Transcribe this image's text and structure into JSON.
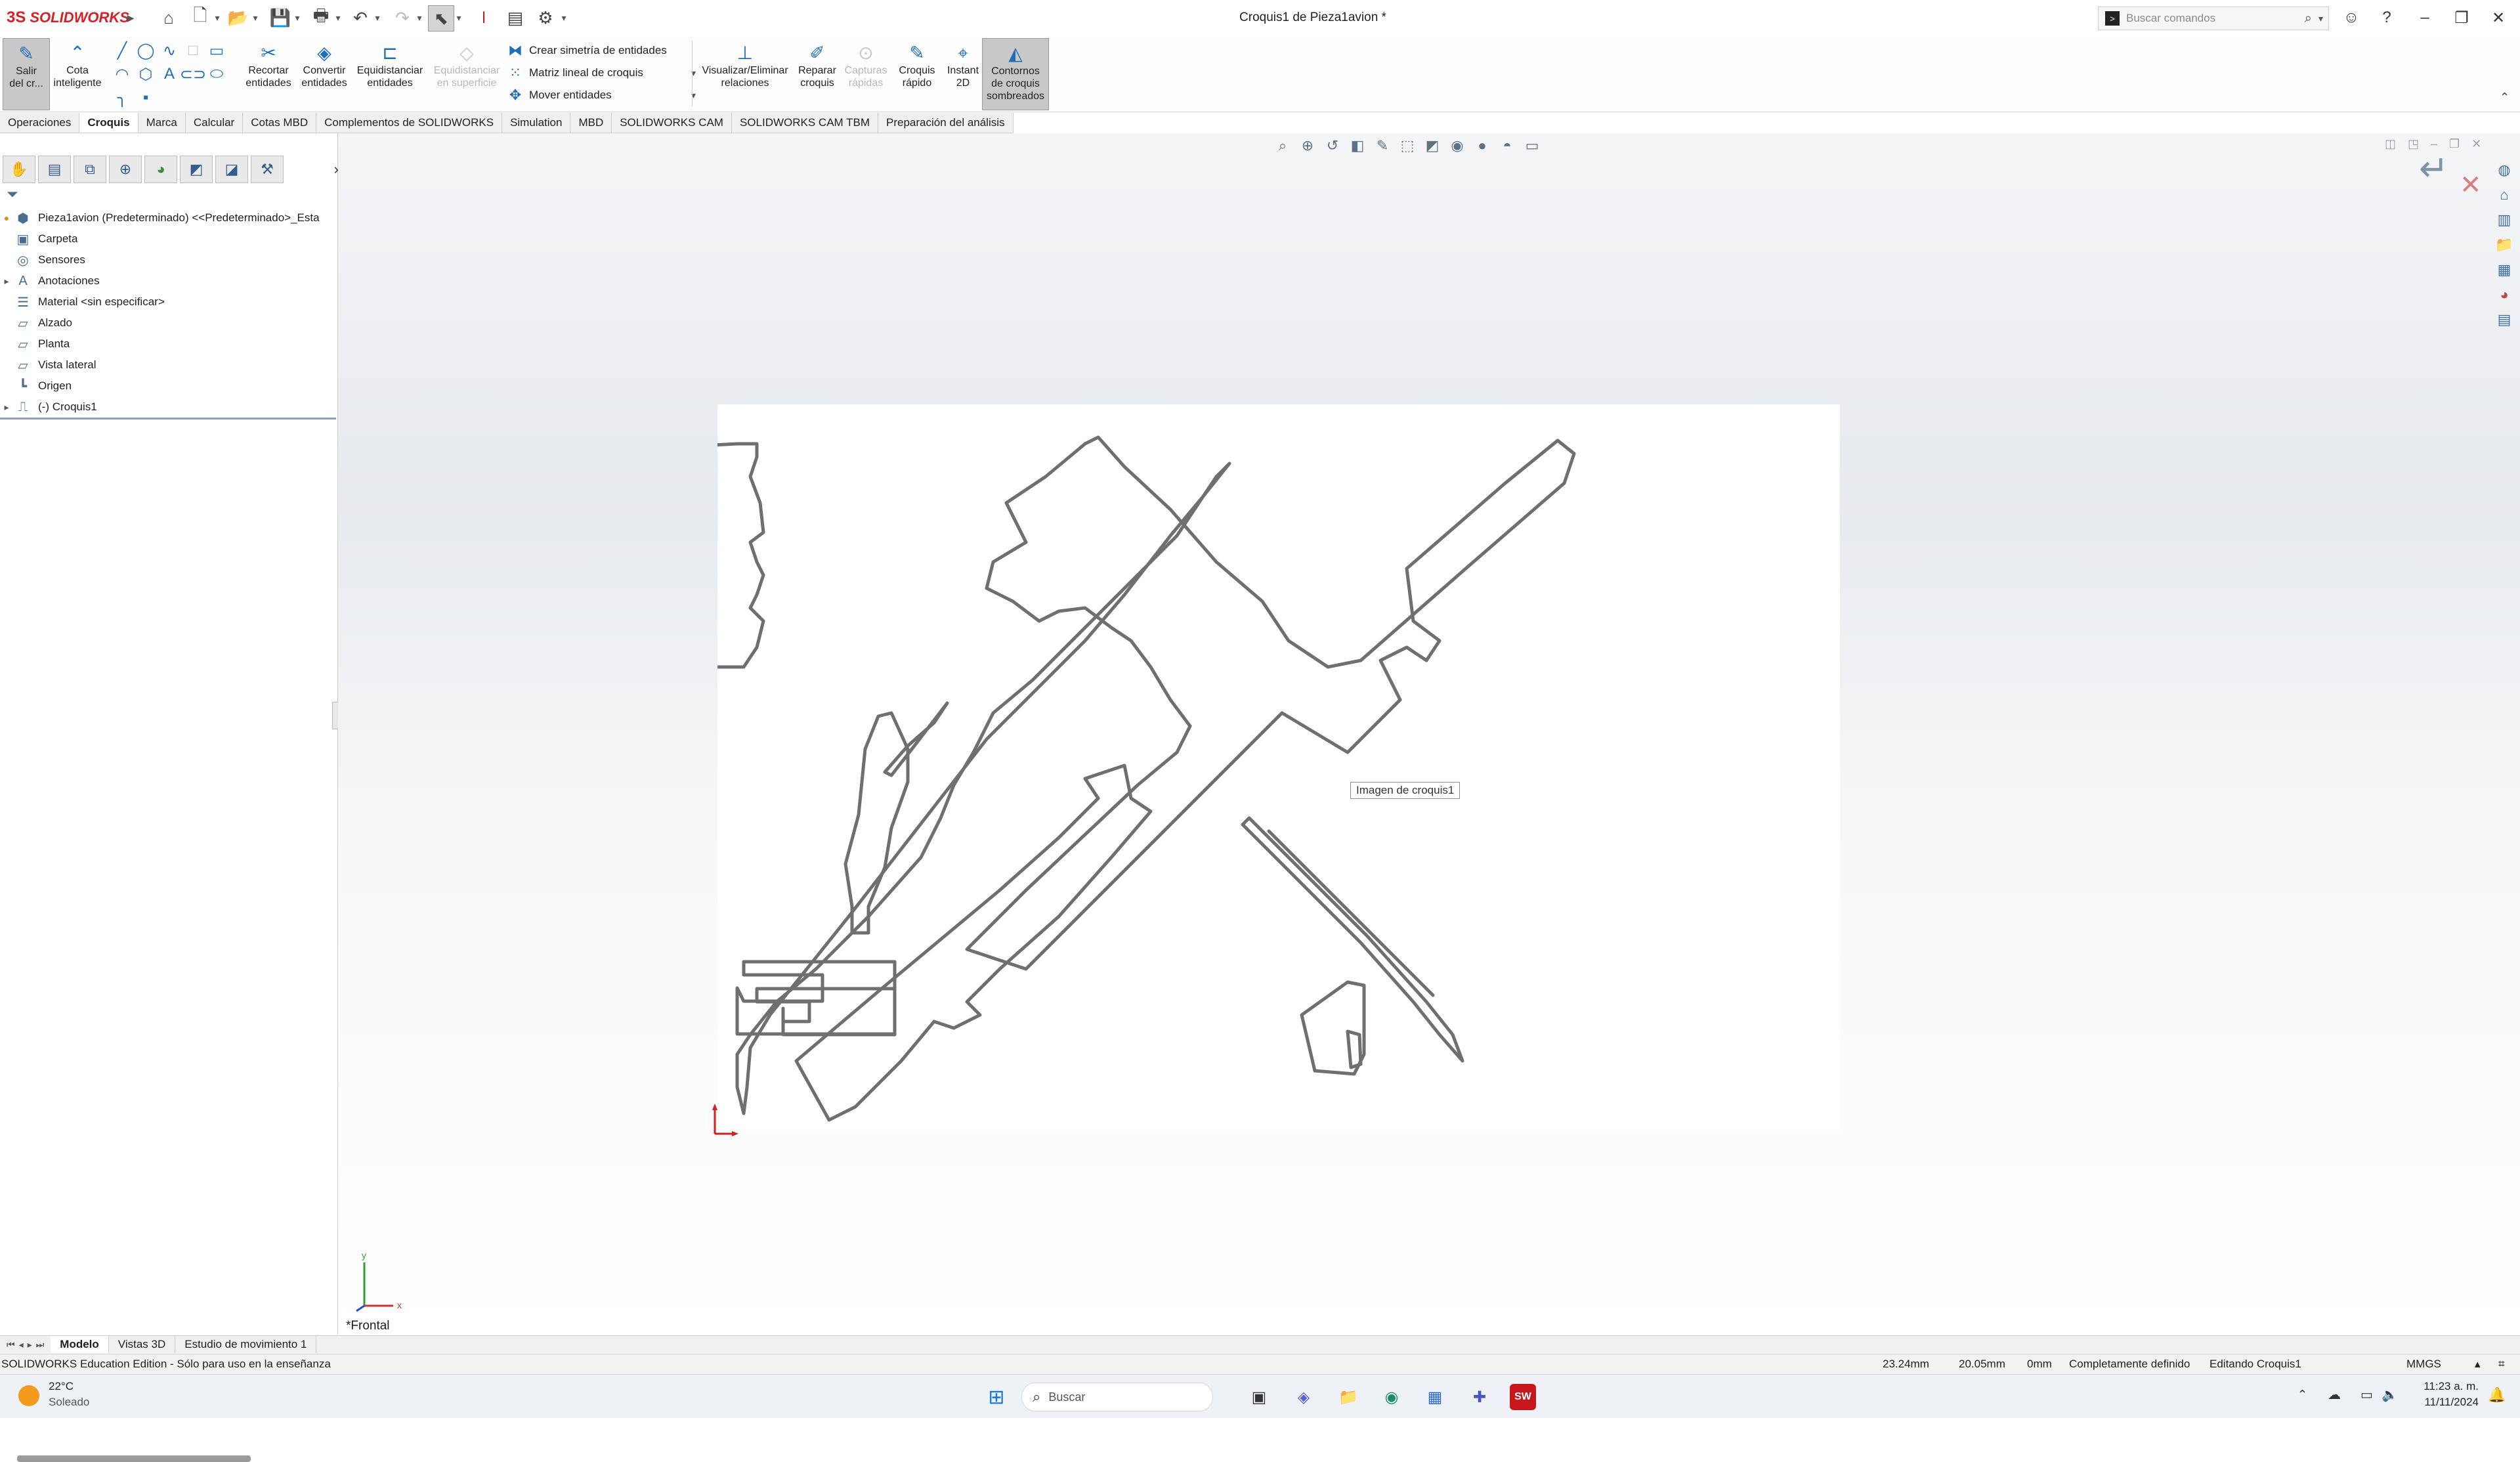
{
  "app": {
    "logo": "SOLIDWORKS",
    "logo_mark": "3S",
    "title": "Croquis1 de Pieza1avion *",
    "search_placeholder": "Buscar comandos"
  },
  "ribbon": {
    "exit_sketch": "Salir\ndel cr...",
    "smart_dim": "Cota\ninteligente",
    "trim": "Recortar\nentidades",
    "convert": "Convertir\nentidades",
    "offset": "Equidistanciar\nentidades",
    "offset_surface": "Equidistanciar\nen superficie",
    "mirror": "Crear simetría de entidades",
    "linear_pattern": "Matriz lineal de croquis",
    "move": "Mover entidades",
    "relations": "Visualizar/Eliminar\nrelaciones",
    "repair": "Reparar\ncroquis",
    "quick_snaps": "Capturas\nrápidas",
    "rapid_sketch": "Croquis\nrápido",
    "instant2d": "Instant\n2D",
    "shaded_contours": "Contornos\nde croquis\nsombreados"
  },
  "tabs": [
    "Operaciones",
    "Croquis",
    "Marca",
    "Calcular",
    "Cotas MBD",
    "Complementos de SOLIDWORKS",
    "Simulation",
    "MBD",
    "SOLIDWORKS CAM",
    "SOLIDWORKS CAM TBM",
    "Preparación del análisis"
  ],
  "tree": {
    "root": "Pieza1avion (Predeterminado) <<Predeterminado>_Esta",
    "items": [
      "Carpeta",
      "Sensores",
      "Anotaciones",
      "Material <sin especificar>",
      "Alzado",
      "Planta",
      "Vista lateral",
      "Origen",
      "(-) Croquis1"
    ]
  },
  "bottom_tabs": [
    "Modelo",
    "Vistas 3D",
    "Estudio de movimiento 1"
  ],
  "viewport": {
    "tooltip": "Imagen de croquis1",
    "view_name": "*Frontal",
    "triad_x": "x",
    "triad_y": "y"
  },
  "status": {
    "edition": "SOLIDWORKS Education Edition - Sólo para uso en la enseñanza",
    "x": "23.24mm",
    "y": "20.05mm",
    "z": "0mm",
    "definition": "Completamente definido",
    "editing": "Editando Croquis1",
    "units": "MMGS"
  },
  "taskbar": {
    "weather_temp": "22°C",
    "weather_desc": "Soleado",
    "search": "Buscar",
    "time": "11:23 a. m.",
    "date": "11/11/2024"
  }
}
